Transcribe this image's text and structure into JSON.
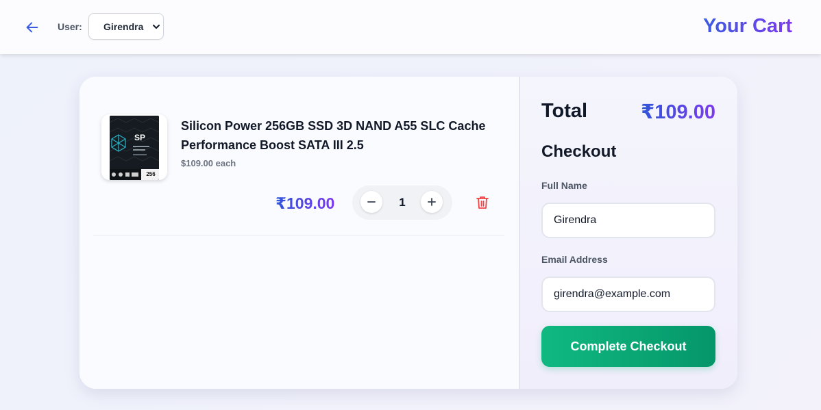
{
  "header": {
    "user_label": "User:",
    "selected_user": "Girendra",
    "title": "Your Cart"
  },
  "cart": {
    "items": [
      {
        "name": "Silicon Power 256GB SSD 3D NAND A55 SLC Cache Performance Boost SATA III 2.5",
        "unit_price": "$109.00 each",
        "line_total": "₹109.00",
        "quantity": "1",
        "image_brand_mark": "SP",
        "image_capacity_mark": "256"
      }
    ]
  },
  "summary": {
    "total_label": "Total",
    "total_value": "₹109.00",
    "checkout_heading": "Checkout",
    "full_name_label": "Full Name",
    "full_name_value": "Girendra",
    "email_label": "Email Address",
    "email_value": "girendra@example.com",
    "submit_label": "Complete Checkout"
  },
  "icons": {
    "back": "arrow-left-icon",
    "select": "chevron-down-icon",
    "decrease": "minus-icon",
    "increase": "plus-icon",
    "delete": "trash-icon"
  },
  "colors": {
    "accent_blue": "#3b5be0",
    "accent_purple": "#7c3aed",
    "checkout_green": "#10b981",
    "delete_red": "#ef4444"
  }
}
